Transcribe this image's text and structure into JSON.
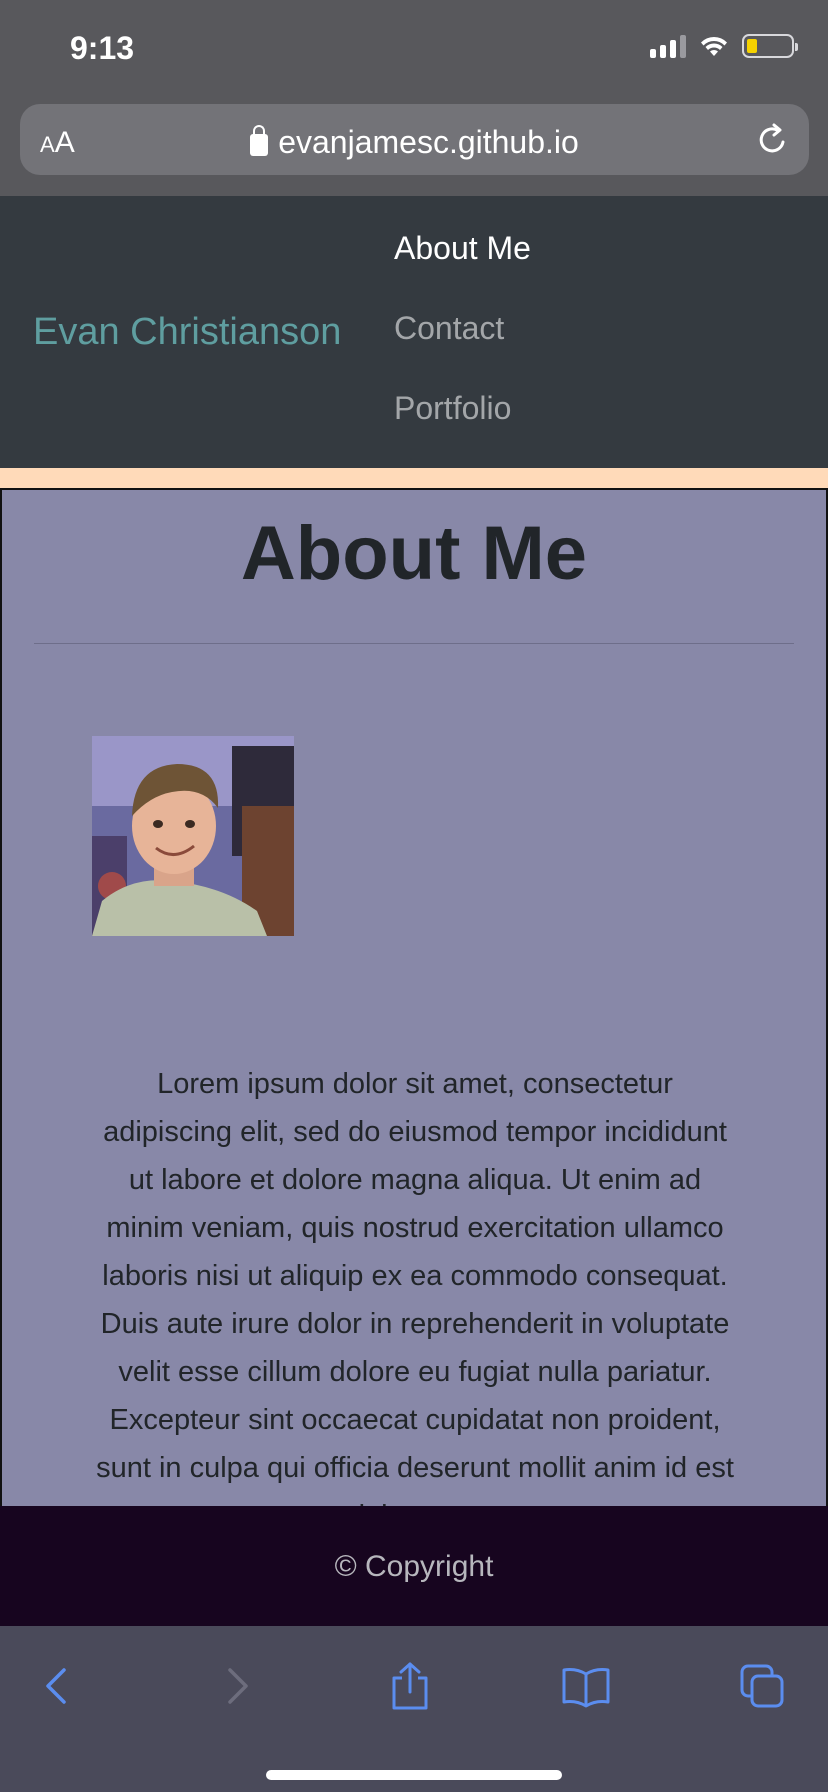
{
  "status_bar": {
    "time": "9:13",
    "signal_icon": "cellular-signal-icon",
    "wifi_icon": "wifi-icon",
    "battery_icon": "battery-icon",
    "battery_level": 0.2
  },
  "browser": {
    "text_size_label": "AA",
    "url": "evanjamesc.github.io",
    "lock_icon": "lock-icon",
    "reload_icon": "reload-icon"
  },
  "nav": {
    "brand": "Evan Christianson",
    "links": [
      {
        "label": "About Me",
        "active": true
      },
      {
        "label": "Contact",
        "active": false
      },
      {
        "label": "Portfolio",
        "active": false
      }
    ]
  },
  "main": {
    "title": "About Me",
    "about_text": "Lorem ipsum dolor sit amet, consectetur adipiscing elit, sed do eiusmod tempor incididunt ut labore et dolore magna aliqua. Ut enim ad minim veniam, quis nostrud exercitation ullamco laboris nisi ut aliquip ex ea commodo consequat. Duis aute irure dolor in reprehenderit in voluptate velit esse cillum dolore eu fugiat nulla pariatur. Excepteur sint occaecat cupidatat non proident, sunt in culpa qui officia deserunt mollit anim id est laborum."
  },
  "footer": {
    "copyright": "© Copyright"
  },
  "toolbar": {
    "icons": [
      "back-icon",
      "forward-icon",
      "share-icon",
      "bookmarks-icon",
      "tabs-icon"
    ]
  },
  "colors": {
    "nav_bg": "#343a40",
    "brand": "#5f9ea0",
    "accent_band": "#ffdab9",
    "card_bg": "#8888a8",
    "footer_bg": "#17051f",
    "toolbar_icon": "#5b8def"
  }
}
